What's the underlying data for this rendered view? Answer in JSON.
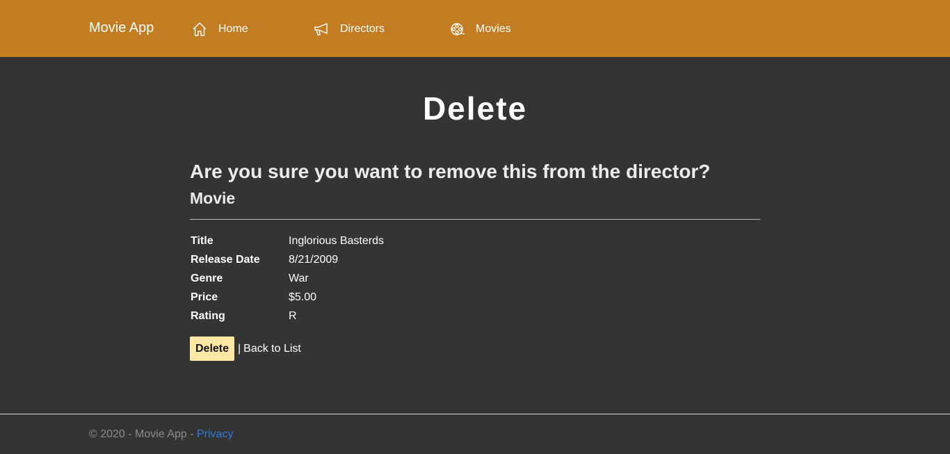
{
  "navbar": {
    "brand": "Movie App",
    "links": [
      {
        "label": "Home",
        "icon": "home-icon"
      },
      {
        "label": "Directors",
        "icon": "megaphone-icon"
      },
      {
        "label": "Movies",
        "icon": "film-reel-icon"
      }
    ],
    "background": "#c27d22"
  },
  "page": {
    "title": "Delete",
    "question": "Are you sure you want to remove this from the director?",
    "entity": "Movie"
  },
  "details": [
    {
      "label": "Title",
      "value": "Inglorious Basterds"
    },
    {
      "label": "Release Date",
      "value": "8/21/2009"
    },
    {
      "label": "Genre",
      "value": "War"
    },
    {
      "label": "Price",
      "value": "$5.00"
    },
    {
      "label": "Rating",
      "value": "R"
    }
  ],
  "actions": {
    "delete_label": "Delete",
    "separator": "|",
    "back_label": "Back to List",
    "delete_button_color": "#ffe8a3"
  },
  "footer": {
    "text": "© 2020 - Movie App -",
    "privacy_label": "Privacy",
    "link_color": "#2f7ad8"
  }
}
